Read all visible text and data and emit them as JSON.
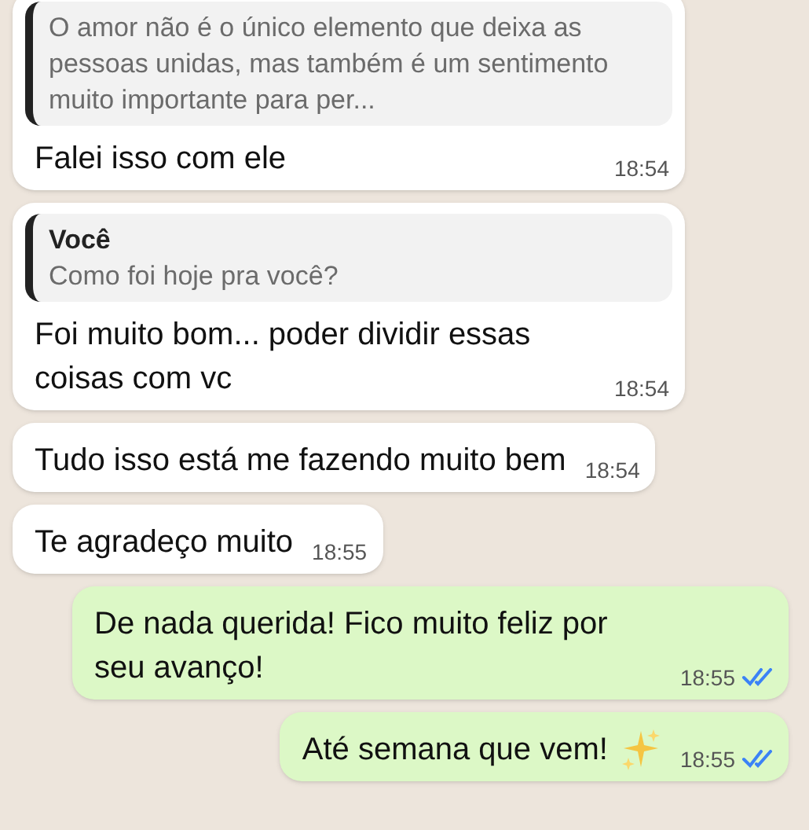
{
  "messages": [
    {
      "kind": "incoming",
      "quote": {
        "text": "O amor não é o único elemento que deixa as pessoas unidas, mas também é um sentimento muito importante para per..."
      },
      "text": "Falei isso com ele",
      "time": "18:54"
    },
    {
      "kind": "incoming",
      "quote": {
        "author": "Você",
        "text": "Como foi hoje pra você?"
      },
      "text": "Foi muito bom... poder dividir essas coisas com vc",
      "time": "18:54"
    },
    {
      "kind": "incoming",
      "text": "Tudo isso está me fazendo muito bem",
      "time": "18:54"
    },
    {
      "kind": "incoming",
      "text": "Te agradeço muito",
      "time": "18:55"
    },
    {
      "kind": "outgoing",
      "text": "De nada querida! Fico muito feliz por seu avanço!",
      "time": "18:55",
      "read": true
    },
    {
      "kind": "outgoing",
      "text": "Até semana que vem!",
      "sparkles": true,
      "time": "18:55",
      "read": true
    }
  ]
}
